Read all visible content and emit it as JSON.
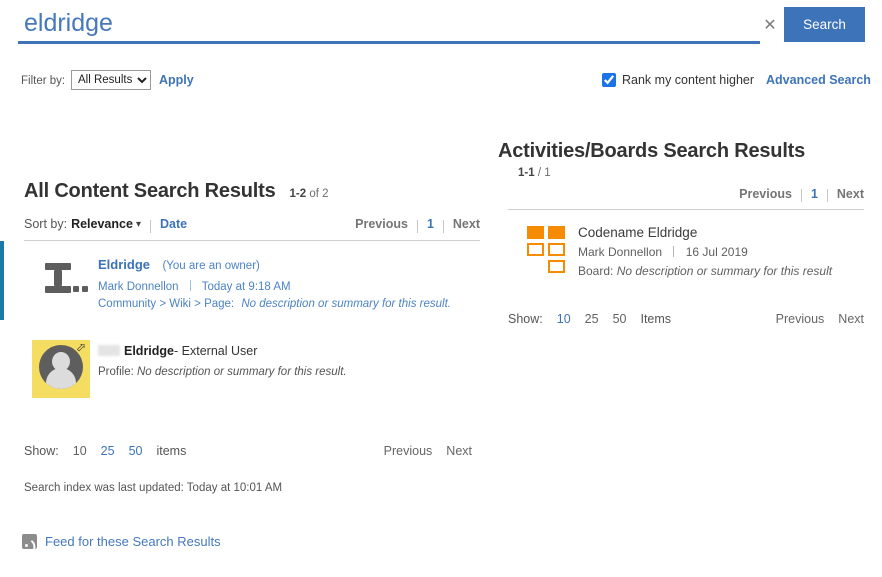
{
  "search": {
    "query": "eldridge",
    "placeholder": "Search",
    "clear_label": "✕",
    "button_label": "Search"
  },
  "filters": {
    "filter_label": "Filter by:",
    "selected_option": "All Results",
    "options": [
      "All Results"
    ],
    "apply_label": "Apply",
    "rank_checkbox_label": "Rank my content higher",
    "rank_checked": true,
    "advanced_search_label": "Advanced Search"
  },
  "left_panel": {
    "title": "All Content Search Results",
    "range": "1-2",
    "range_suffix": "of 2",
    "sort_label": "Sort by:",
    "sort_active": "Relevance",
    "sort_other": "Date",
    "pager": {
      "previous": "Previous",
      "page": "1",
      "next": "Next"
    },
    "results": [
      {
        "icon": "document-ibeam-icon",
        "title": "Eldridge",
        "owner_note": "(You are an owner)",
        "author": "Mark Donnellon",
        "date": "Today at 9:18 AM",
        "path": "Community > Wiki > Page:",
        "description": "No description or summary for this result.",
        "selected": true
      },
      {
        "icon": "user-avatar-icon",
        "redacted_name": "",
        "title": "Eldridge",
        "title_suffix": "- External User",
        "profile_label": "Profile:",
        "description": "No description or summary for this result."
      }
    ],
    "show": {
      "label": "Show:",
      "counts": [
        "10",
        "25",
        "50"
      ],
      "current": "10",
      "units": "items",
      "previous": "Previous",
      "next": "Next"
    },
    "index_note": "Search index was last updated:  Today at 10:01 AM",
    "feed_label": "Feed for these Search Results"
  },
  "right_panel": {
    "title": "Activities/Boards Search Results",
    "range": "1-1",
    "range_suffix": "/ 1",
    "pager": {
      "previous": "Previous",
      "page": "1",
      "next": "Next"
    },
    "results": [
      {
        "icon": "board-tiles-icon",
        "title": "Codename Eldridge",
        "author": "Mark Donnellon",
        "date": "16 Jul 2019",
        "board_label": "Board:",
        "description": "No description or summary for this result"
      }
    ],
    "show": {
      "label": "Show:",
      "counts": [
        "10",
        "25",
        "50"
      ],
      "current": "10",
      "units": "Items",
      "previous": "Previous",
      "next": "Next"
    }
  },
  "colors": {
    "accent_blue": "#3d73b8",
    "link_blue": "#4579bc",
    "selected_bar": "#1a7ba8",
    "board_orange": "#f58b00",
    "avatar_yellow": "#f5dd62"
  }
}
